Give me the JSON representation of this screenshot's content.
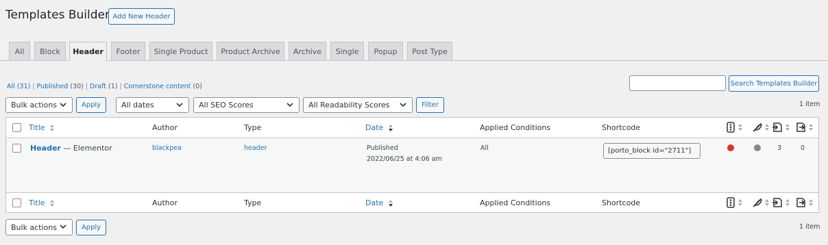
{
  "header": {
    "title": "Templates Builder",
    "add_new_label": "Add New Header"
  },
  "tabs": [
    "All",
    "Block",
    "Header",
    "Footer",
    "Single Product",
    "Product Archive",
    "Archive",
    "Single",
    "Popup",
    "Post Type"
  ],
  "active_tab": "Header",
  "filters": {
    "all_label": "All",
    "all_count": "(31)",
    "published_label": "Published",
    "published_count": "(30)",
    "draft_label": "Draft",
    "draft_count": "(1)",
    "cornerstone_label": "Cornerstone content",
    "cornerstone_count": "(0)"
  },
  "search": {
    "button_label": "Search Templates Builder",
    "value": ""
  },
  "top_nav": {
    "bulk_actions": "Bulk actions",
    "apply_label": "Apply",
    "dates": "All dates",
    "seo": "All SEO Scores",
    "readability": "All Readability Scores",
    "filter_label": "Filter",
    "items_count": "1 item"
  },
  "bottom_nav": {
    "bulk_actions": "Bulk actions",
    "apply_label": "Apply",
    "items_count": "1 item"
  },
  "columns": {
    "title": "Title",
    "author": "Author",
    "type": "Type",
    "date": "Date",
    "applied_conditions": "Applied Conditions",
    "shortcode": "Shortcode"
  },
  "rows": [
    {
      "title": "Header",
      "title_suffix": " — Elementor",
      "author": "blackpea",
      "type": "header",
      "status": "Published",
      "date": "2022/06/25 at 4:06 am",
      "applied_conditions": "All",
      "shortcode": "[porto_block id=\"2711\"]",
      "seo_score_color": "#dc3232",
      "readability_color": "#888888",
      "links_out": "3",
      "links_in": "0"
    }
  ],
  "colors": {
    "accent": "#2271b1",
    "border": "#c3c4c7",
    "background": "#f0f0f1"
  }
}
